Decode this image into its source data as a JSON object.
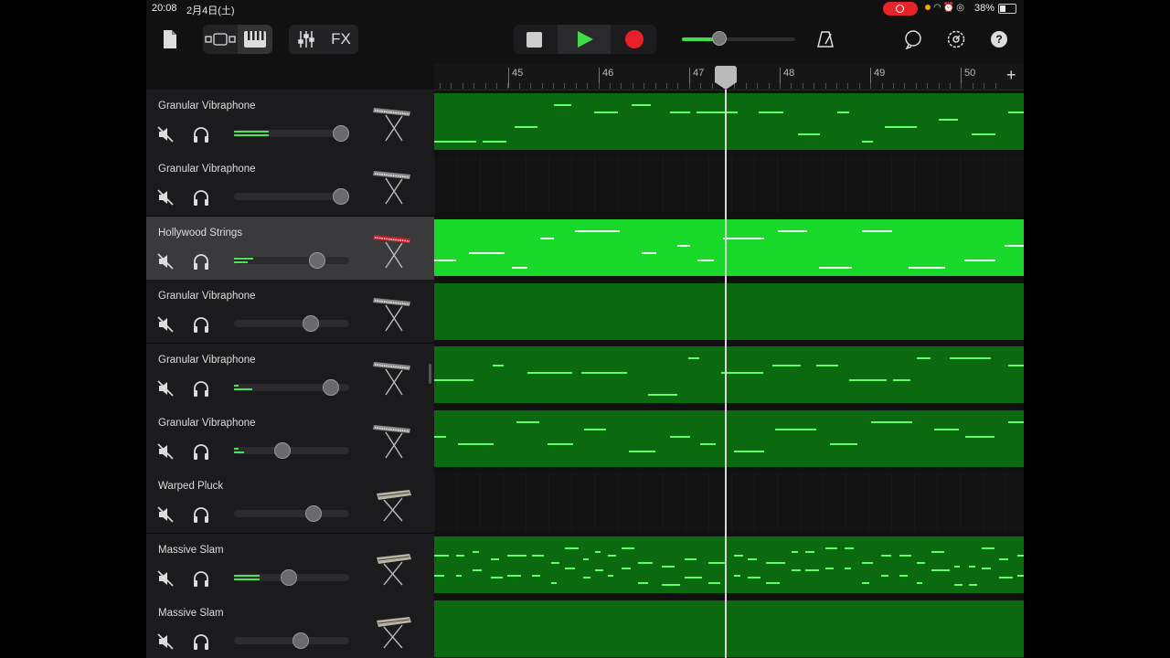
{
  "status_bar": {
    "time": "20:08",
    "date": "2月4日(土)",
    "battery": "38%"
  },
  "toolbar": {
    "icons": [
      "document-icon",
      "tracks-view-icon",
      "piano-keyboard-icon",
      "mixer-icon",
      "metronome-icon",
      "loop-browser-icon",
      "settings-icon",
      "help-icon"
    ],
    "fx_label": "FX",
    "help_label": "?",
    "master_volume": 0.33,
    "accent": "#3fdc4c",
    "record_color": "#e8202a"
  },
  "ruler": {
    "bars": [
      "45",
      "46",
      "47",
      "48",
      "49",
      "50"
    ],
    "add_label": "+"
  },
  "playhead_bar": 47.4,
  "tracks": [
    {
      "name": "Granular Vibraphone",
      "volume": 0.93,
      "level_bars": [
        0.3,
        0.3
      ],
      "instrument": "keyboard",
      "selected": false,
      "region": "notes",
      "region_color": "#0b6a0f"
    },
    {
      "name": "Granular Vibraphone",
      "volume": 0.93,
      "level_bars": [],
      "instrument": "keyboard",
      "selected": false,
      "region": "none",
      "region_color": "#131313"
    },
    {
      "name": "Hollywood Strings",
      "volume": 0.72,
      "level_bars": [
        0.17,
        0.12
      ],
      "instrument": "keyboard-red",
      "selected": true,
      "region": "notes",
      "region_color": "#18d82a"
    },
    {
      "name": "Granular Vibraphone",
      "volume": 0.67,
      "level_bars": [],
      "instrument": "keyboard",
      "selected": false,
      "region": "empty",
      "region_color": "#0b6a0f"
    },
    {
      "name": "Granular Vibraphone",
      "volume": 0.84,
      "level_bars": [
        0.04,
        0.16
      ],
      "instrument": "keyboard",
      "selected": false,
      "region": "notes",
      "region_color": "#0b6a0f"
    },
    {
      "name": "Granular Vibraphone",
      "volume": 0.42,
      "level_bars": [
        0.04,
        0.09
      ],
      "instrument": "keyboard",
      "selected": false,
      "region": "notes",
      "region_color": "#0b6a0f"
    },
    {
      "name": "Warped Pluck",
      "volume": 0.69,
      "level_bars": [],
      "instrument": "synth",
      "selected": false,
      "region": "none",
      "region_color": "#131313"
    },
    {
      "name": "Massive Slam",
      "volume": 0.48,
      "level_bars": [
        0.22,
        0.22
      ],
      "instrument": "synth",
      "selected": false,
      "region": "notes",
      "region_color": "#0b6a0f"
    },
    {
      "name": "Massive Slam",
      "volume": 0.58,
      "level_bars": [],
      "instrument": "synth",
      "selected": false,
      "region": "empty",
      "region_color": "#0b6a0f"
    }
  ]
}
